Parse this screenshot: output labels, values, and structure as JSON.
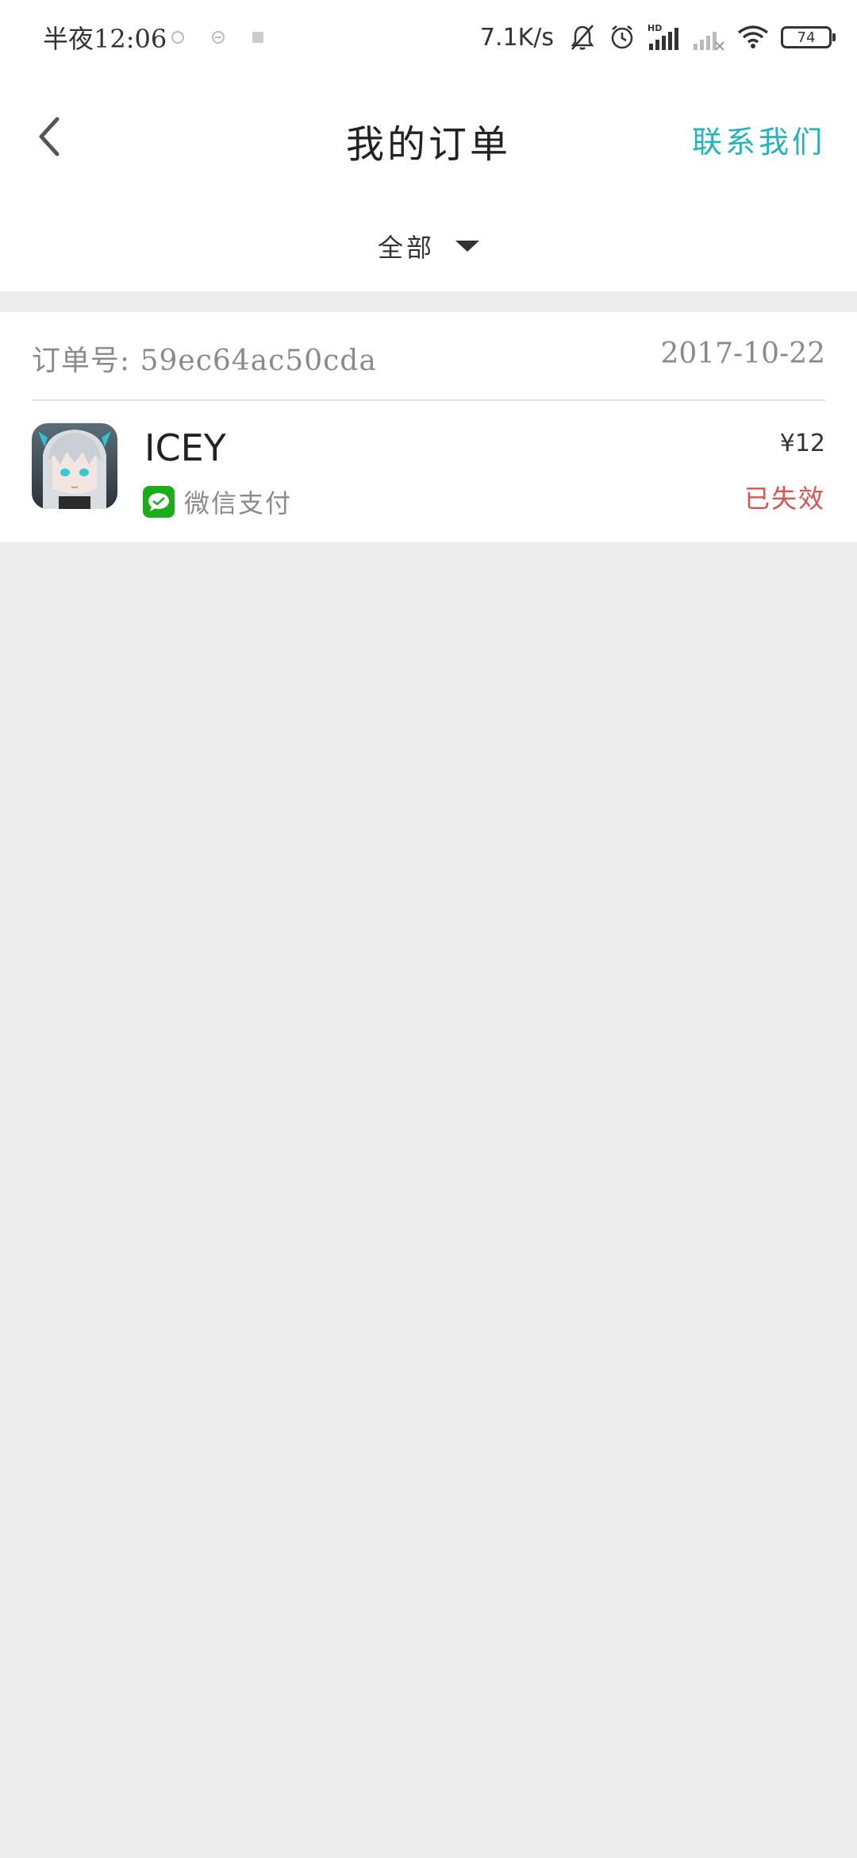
{
  "status_bar": {
    "time": "半夜12:06",
    "net_speed": "7.1K/s",
    "battery": "74",
    "hd_label": "HD"
  },
  "header": {
    "title": "我的订单",
    "contact": "联系我们"
  },
  "filter": {
    "label": "全部"
  },
  "orders": [
    {
      "order_no_label": "订单号:",
      "order_no": "59ec64ac50cda",
      "date": "2017-10-22",
      "product": "ICEY",
      "payment": "微信支付",
      "price": "¥12",
      "status": "已失效"
    }
  ],
  "colors": {
    "accent": "#26b3b8",
    "invalid": "#d9534f",
    "wechat": "#1aad19",
    "background": "#ececec"
  }
}
